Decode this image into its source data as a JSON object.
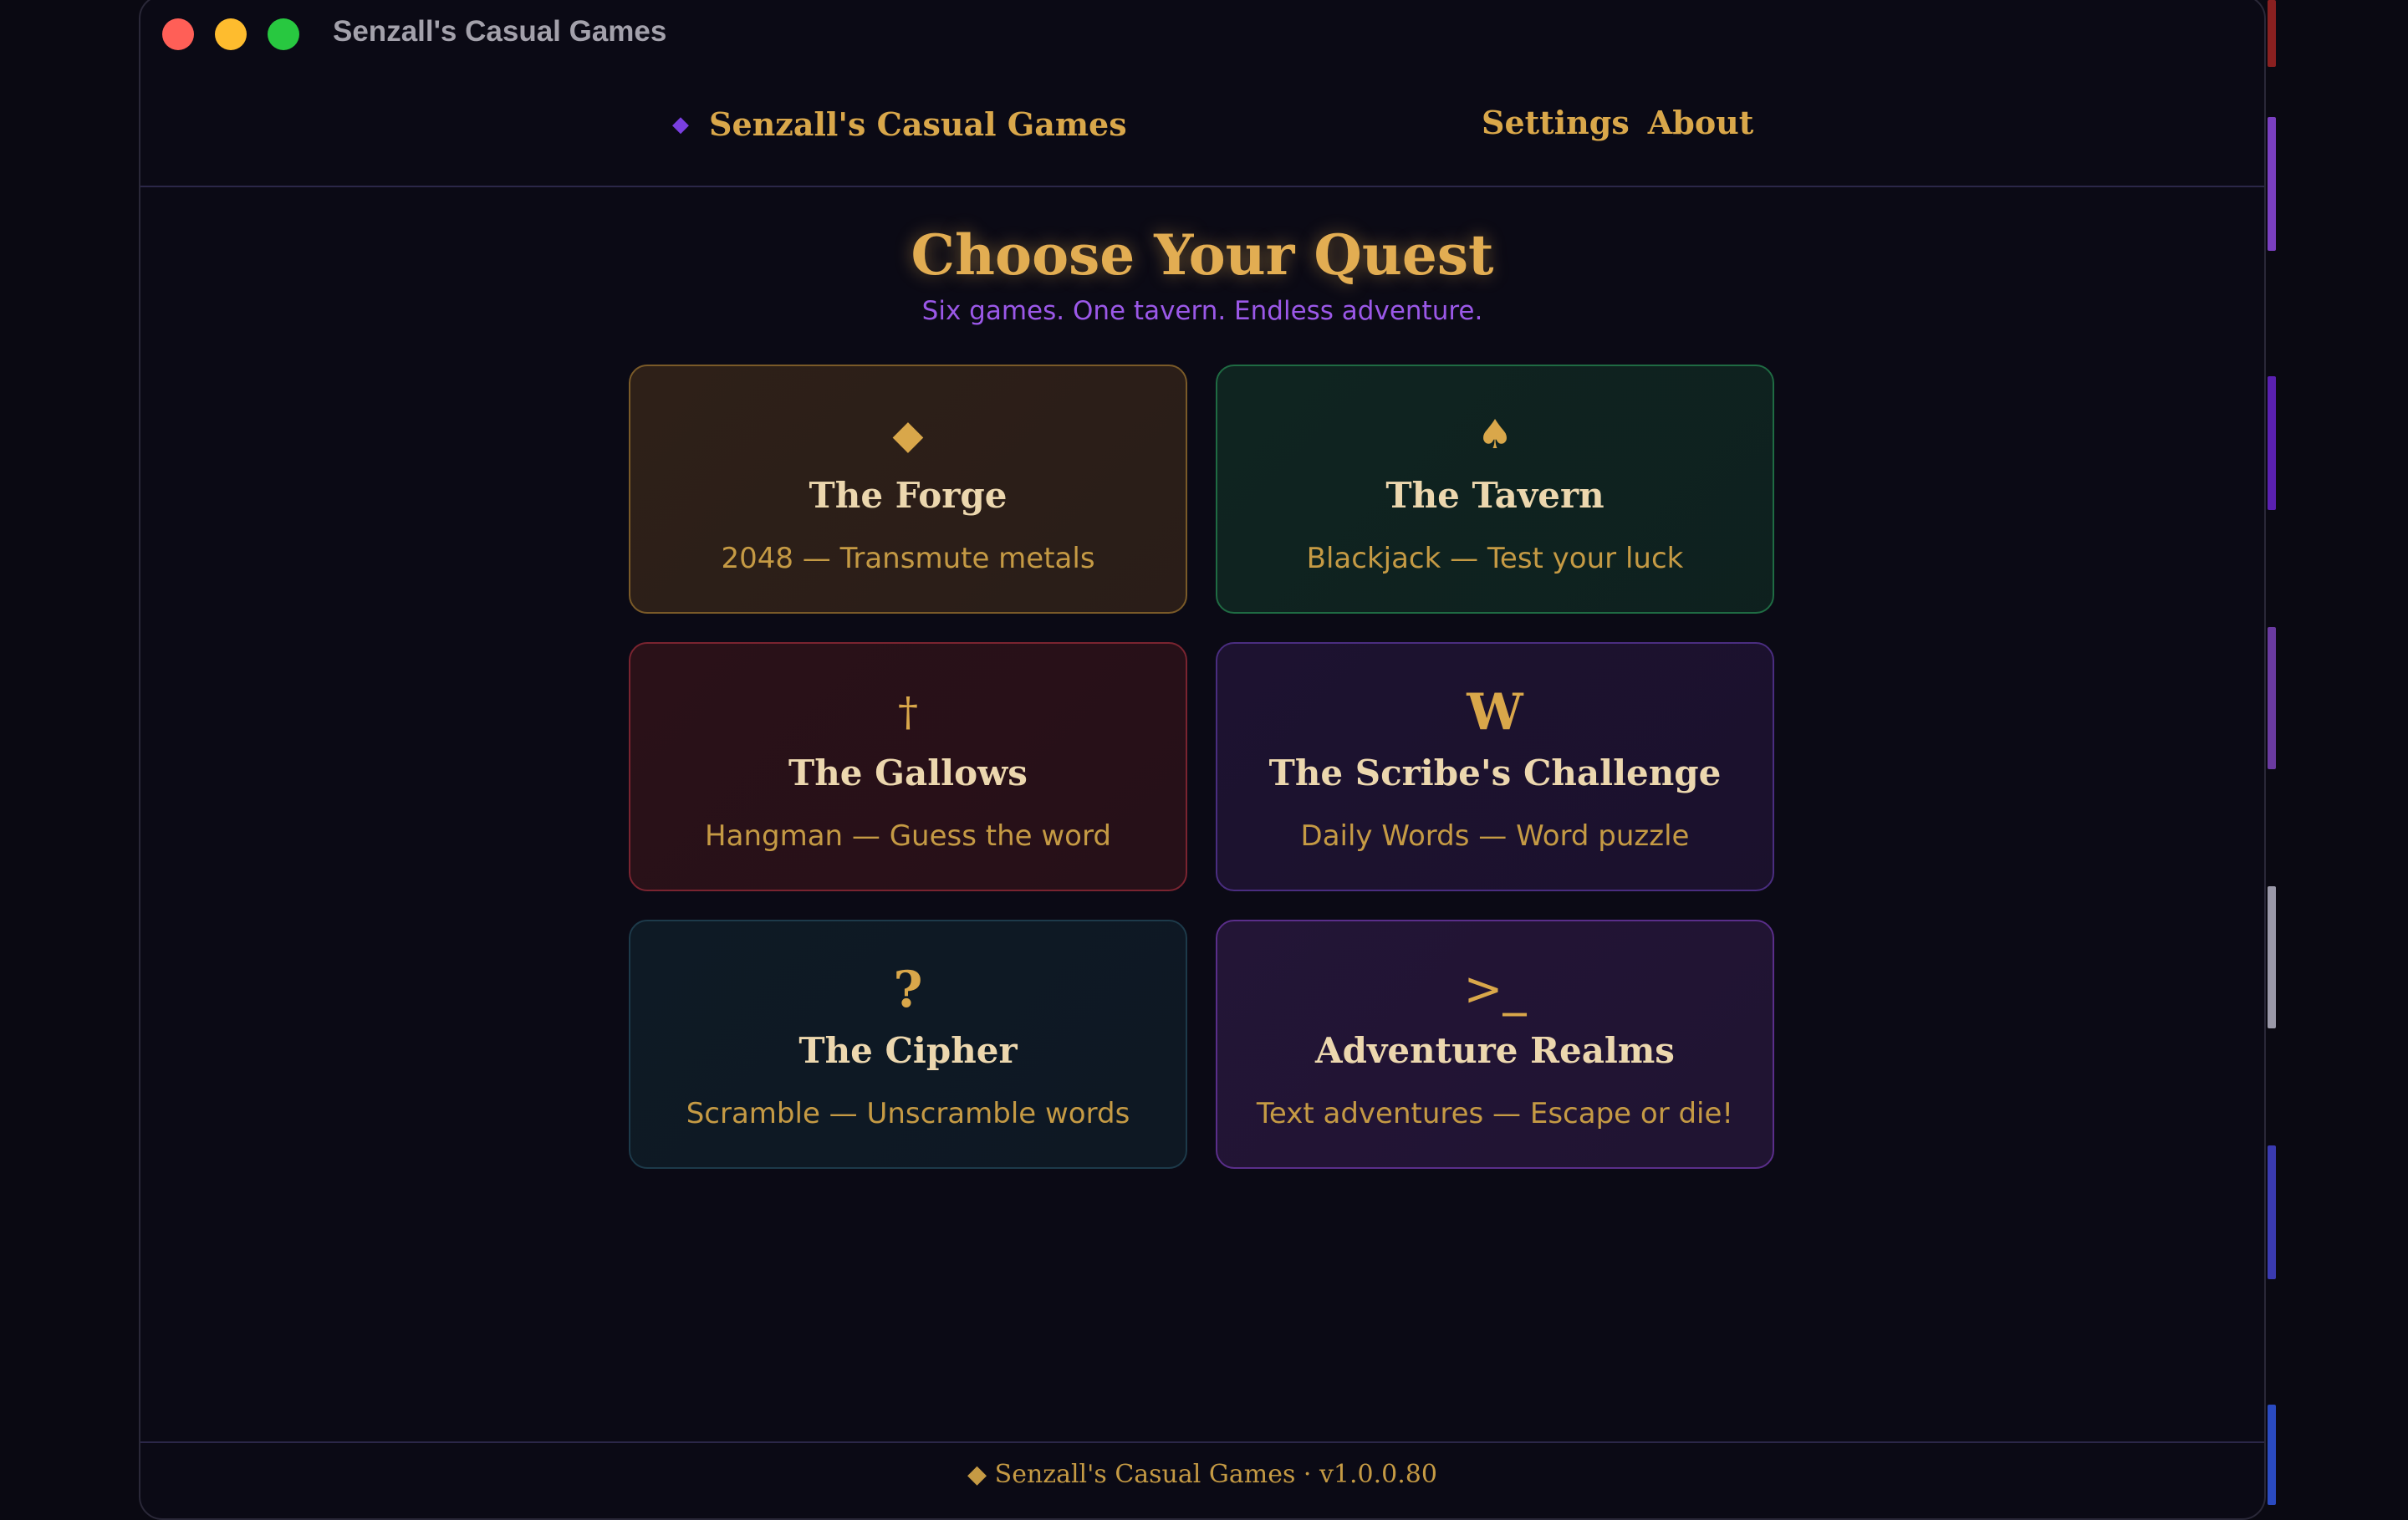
{
  "window": {
    "title": "Senzall's Casual Games"
  },
  "navbar": {
    "brand_icon": "diamond-icon",
    "brand": "Senzall's Casual Games",
    "links": [
      "Settings",
      "About"
    ]
  },
  "hero": {
    "title": "Choose Your Quest",
    "subtitle": "Six games. One tavern. Endless adventure."
  },
  "cards": [
    {
      "icon": "◆",
      "icon_name": "diamond-icon",
      "title": "The Forge",
      "desc": "2048 — Transmute metals",
      "bg": "#2e2018",
      "border": "#7a5a28"
    },
    {
      "icon": "♠",
      "icon_name": "spade-icon",
      "title": "The Tavern",
      "desc": "Blackjack — Test your luck",
      "bg": "#0f2420",
      "border": "#1f6b43"
    },
    {
      "icon": "†",
      "icon_name": "dagger-icon",
      "title": "The Gallows",
      "desc": "Hangman — Guess the word",
      "bg": "#2a1118",
      "border": "#7a2430"
    },
    {
      "icon": "W",
      "icon_name": "letter-w-icon",
      "title": "The Scribe's Challenge",
      "desc": "Daily Words — Word puzzle",
      "bg": "#1d1230",
      "border": "#4a2d80"
    },
    {
      "icon": "?",
      "icon_name": "question-mark-icon",
      "title": "The Cipher",
      "desc": "Scramble — Unscramble words",
      "bg": "#0e1a25",
      "border": "#1d3a4a"
    },
    {
      "icon": ">_",
      "icon_name": "terminal-prompt-icon",
      "title": "Adventure Realms",
      "desc": "Text adventures — Escape or die!",
      "bg": "#231536",
      "border": "#5a2e8a"
    }
  ],
  "footer": {
    "text": "◆ Senzall's Casual Games · v1.0.0.80"
  },
  "colors": {
    "accent_gold": "#d9a74a",
    "accent_purple": "#9b58e8",
    "background": "#0b0a15"
  }
}
